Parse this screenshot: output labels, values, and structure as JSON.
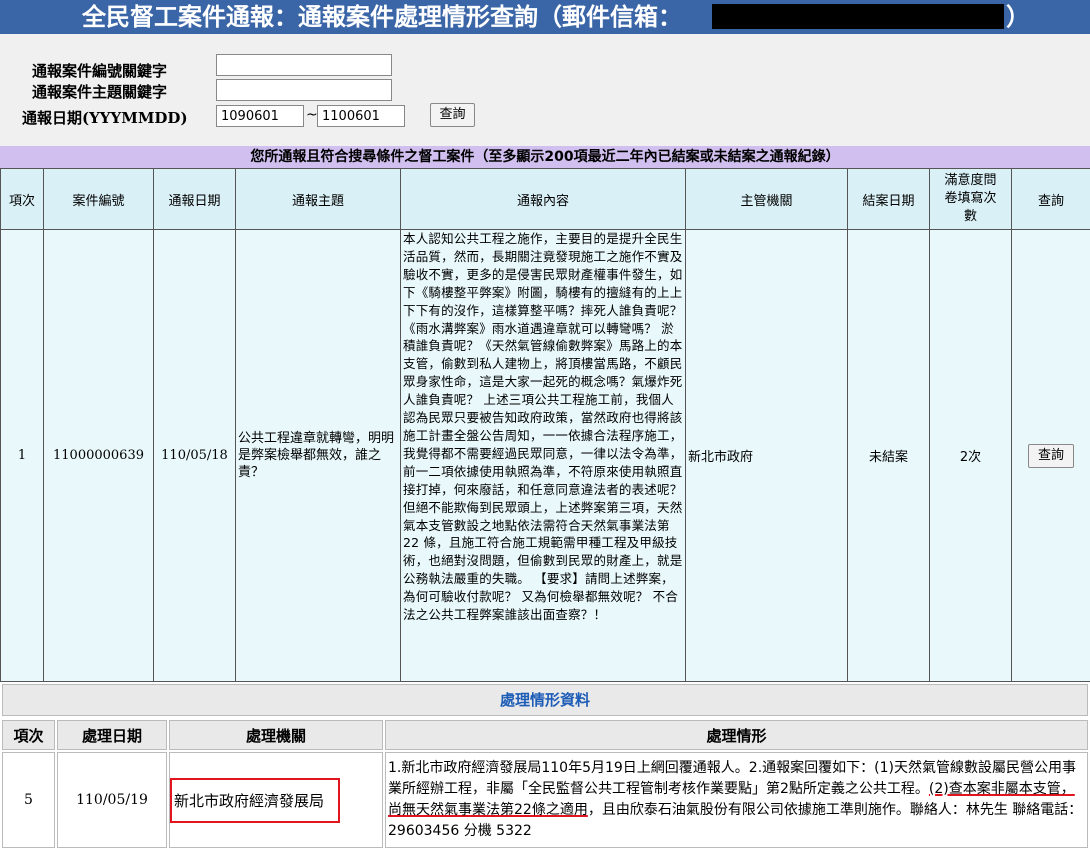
{
  "page": {
    "title": "全民督工案件通報：通報案件處理情形查詢（郵件信箱：",
    "title_close": "）"
  },
  "search": {
    "case_no_label": "通報案件編號關鍵字",
    "subject_label": "通報案件主題關鍵字",
    "date_label": "通報日期(YYYMMDD)",
    "case_no_value": "",
    "subject_value": "",
    "date_from": "1090601",
    "date_to": "1100601",
    "range_sep": "~",
    "query_button": "查詢"
  },
  "results": {
    "banner": "您所通報且符合搜尋條件之督工案件（至多顯示200項最近二年內已結案或未結案之通報紀錄）",
    "headers": {
      "item": "項次",
      "case_no": "案件編號",
      "date": "通報日期",
      "subject": "通報主題",
      "content": "通報內容",
      "agency": "主管機關",
      "closed": "結案日期",
      "survey": "滿意度問卷填寫次數",
      "query": "查詢"
    },
    "rows": [
      {
        "item": "1",
        "case_no": "11000000639",
        "date": "110/05/18",
        "subject": "公共工程違章就轉彎，明明是弊案檢舉都無效，誰之責？",
        "content": "本人認知公共工程之施作，主要目的是提升全民生活品質，然而，長期關注竟發現施工之施作不實及驗收不實，更多的是侵害民眾財產權事件發生，如下《騎樓整平弊案》附圖，騎樓有的擅縫有的上上下下有的沒作，這樣算整平嗎？摔死人誰負責呢？《雨水溝弊案》雨水道遇違章就可以轉彎嗎？ 淤積誰負責呢？《天然氣管線偷數弊案》馬路上的本支管，偷數到私人建物上，將頂樓當馬路，不顧民眾身家性命，這是大家一起死的概念嗎？氣爆炸死人誰負責呢？ 上述三項公共工程施工前，我個人認為民眾只要被告知政府政策，當然政府也得將該施工計畫全盤公告周知，一一依據合法程序施工，我覺得都不需要經過民眾同意，一律以法令為準，前一二項依據使用執照為準，不符原來使用執照直接打掉，何來廢話，和任意同意違法者的表述呢？但絕不能欺侮到民眾頭上，上述弊案第三項，天然氣本支管數設之地點依法需符合天然氣事業法第22 條，且施工符合施工規範需甲種工程及甲級技術，也絕對沒問題，但偷數到民眾的財產上，就是公務執法嚴重的失職。 【要求】請問上述弊案，為何可驗收付款呢？ 又為何檢舉都無效呢？ 不合法之公共工程弊案誰該出面查察？！",
        "agency": "新北市政府",
        "closed": "未結案",
        "survey": "2次",
        "query_button": "查詢"
      }
    ]
  },
  "processing": {
    "section_title": "處理情形資料",
    "headers": {
      "item": "項次",
      "date": "處理日期",
      "agency": "處理機關",
      "situation": "處理情形"
    },
    "rows": [
      {
        "item": "5",
        "date": "110/05/19",
        "agency": "新北市政府經濟發展局",
        "situation_part1": "1.新北市政府經濟發展局110年5月19日上網回覆通報人。2.通報案回覆如下：(1)天然氣管線數設屬民營公用事業所經辦工程，非屬「全民監督公共工程管制考核作業要點」第2點所定義之公共工程。",
        "situation_underlined": "(2)查本案非屬本支管，尚無天然氣事業法第22條之適用",
        "situation_part2": "，且由欣泰石油氣股份有限公司依據施工準則施作。聯絡人：林先生 聯絡電話：29603456 分機 5322"
      }
    ]
  },
  "colors": {
    "title_bar": "#3a66a7",
    "banner": "#d1c0ef",
    "row_bg": "#e8f8fb",
    "highlight": "#e0151d",
    "section_title": "#1e5db7"
  }
}
